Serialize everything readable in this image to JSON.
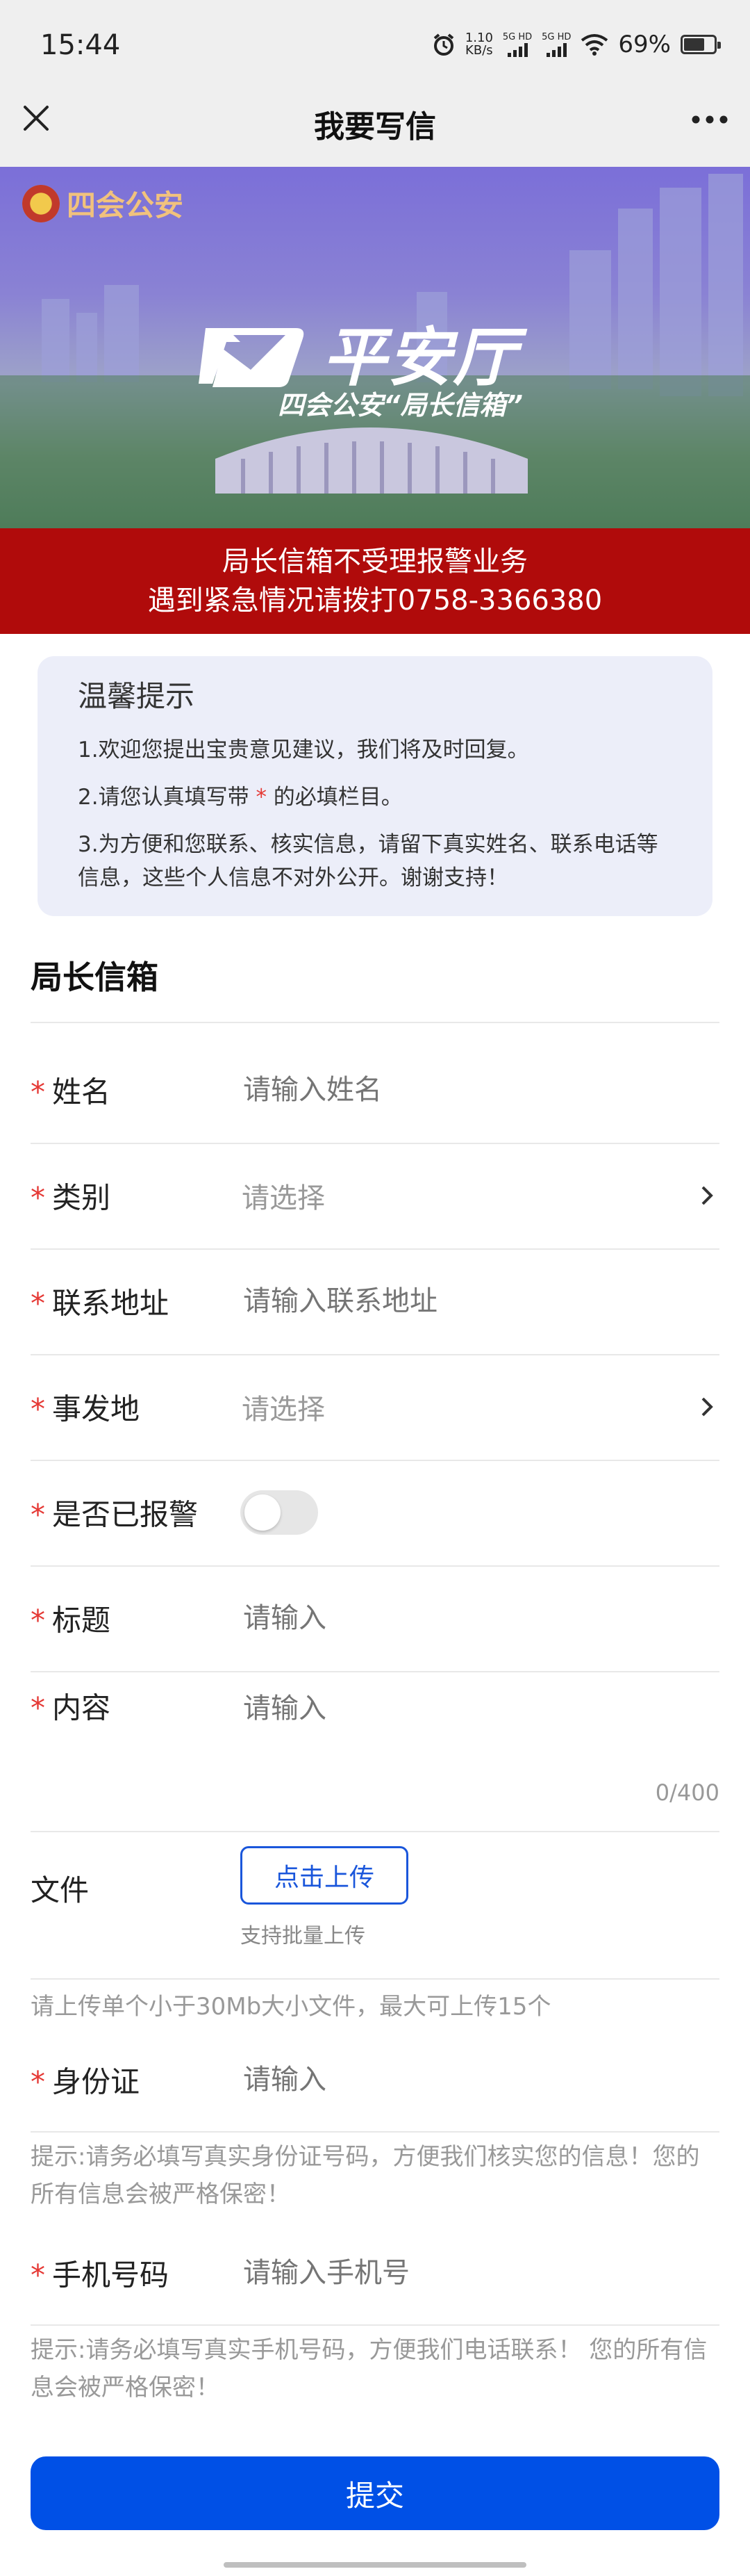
{
  "status_bar": {
    "time": "15:44",
    "net_speed_value": "1.10",
    "net_speed_unit": "KB/s",
    "sim1": "5G HD",
    "sim2": "5G HD",
    "battery": "69%",
    "battery_level": 0.69
  },
  "titlebar": {
    "title": "我要写信"
  },
  "banner": {
    "logo_text": "四会公安",
    "brand_name": "平安厅",
    "brand_sub": "四会公安“局长信箱”",
    "notice_line1": "局长信箱不受理报警业务",
    "notice_line2": "遇到紧急情况请拨打0758-3366380"
  },
  "tips": {
    "title": "温馨提示",
    "item1": "1.欢迎您提出宝贵意见建议，我们将及时回复。",
    "item2_pre": "2.请您认真填写带",
    "item2_star": "*",
    "item2_post": "的必填栏目。",
    "item3": "3.为方便和您联系、核实信息，请留下真实姓名、联系电话等信息，这些个人信息不对外公开。谢谢支持！"
  },
  "form": {
    "section_title": "局长信箱",
    "required_mark": "*",
    "name": {
      "label": "姓名",
      "placeholder": "请输入姓名"
    },
    "category": {
      "label": "类别",
      "placeholder": "请选择"
    },
    "address": {
      "label": "联系地址",
      "placeholder": "请输入联系地址"
    },
    "location": {
      "label": "事发地",
      "placeholder": "请选择"
    },
    "reported": {
      "label": "是否已报警",
      "value": false
    },
    "subject": {
      "label": "标题",
      "placeholder": "请输入"
    },
    "content": {
      "label": "内容",
      "placeholder": "请输入",
      "counter": "0/400"
    },
    "file": {
      "label": "文件",
      "button": "点击上传",
      "hint": "支持批量上传",
      "note": "请上传单个小于30Mb大小文件，最大可上传15个"
    },
    "id_card": {
      "label": "身份证",
      "placeholder": "请输入",
      "hint": "提示:请务必填写真实身份证号码，方便我们核实您的信息！您的所有信息会被严格保密！"
    },
    "phone": {
      "label": "手机号码",
      "placeholder": "请输入手机号",
      "hint": "提示:请务必填写真实手机号码，方便我们电话联系！ 您的所有信息会被严格保密！"
    },
    "submit": "提交"
  }
}
